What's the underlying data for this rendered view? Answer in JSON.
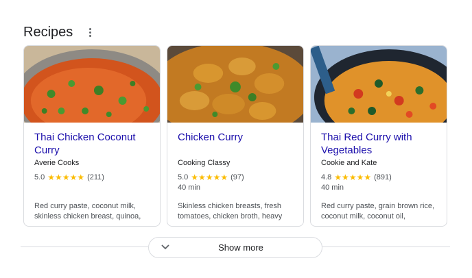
{
  "header": {
    "title": "Recipes"
  },
  "cards": [
    {
      "title": "Thai Chicken Coconut Curry",
      "source": "Averie Cooks",
      "rating": "5.0",
      "stars": "★★★★★",
      "reviews": "(211)",
      "time": "",
      "ingredients": "Red curry paste, coconut milk, skinless chicken breast, quinoa,"
    },
    {
      "title": "Chicken Curry",
      "source": "Cooking Classy",
      "rating": "5.0",
      "stars": "★★★★★",
      "reviews": "(97)",
      "time": "40 min",
      "ingredients": "Skinless chicken breasts, fresh tomatoes, chicken broth, heavy"
    },
    {
      "title": "Thai Red Curry with Vegetables",
      "source": "Cookie and Kate",
      "rating": "4.8",
      "stars": "★★★★★",
      "reviews": "(891)",
      "time": "40 min",
      "ingredients": "Red curry paste, grain brown rice, coconut milk, coconut oil,"
    }
  ],
  "show_more": {
    "label": "Show more"
  },
  "colors": {
    "title_link": "#1a0dab",
    "star": "#fbbc04",
    "border": "#dadce0"
  }
}
